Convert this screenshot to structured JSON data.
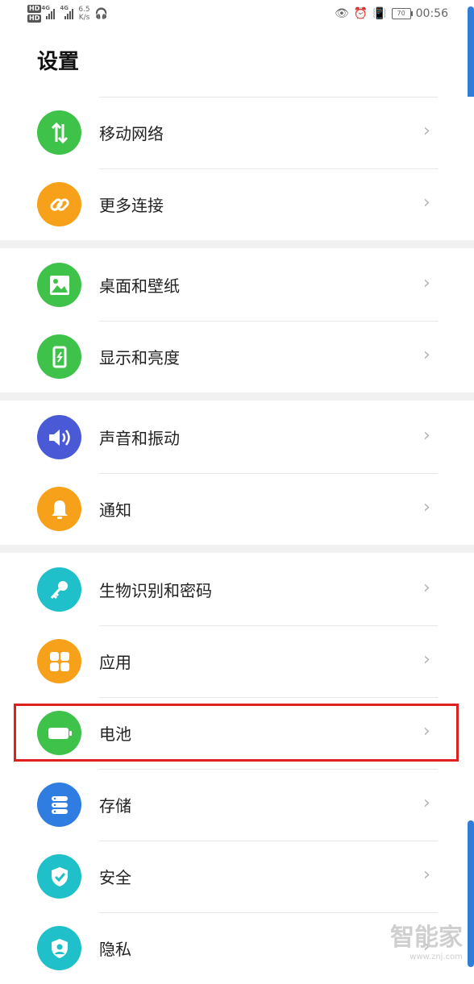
{
  "status_bar": {
    "hd1": "HD",
    "hd2": "HD",
    "net1": "4G",
    "net2": "4G",
    "speed_value": "6.5",
    "speed_unit": "K/s",
    "battery_level": "70",
    "time": "00:56"
  },
  "page": {
    "title": "设置"
  },
  "groups": [
    {
      "items": [
        {
          "label": "移动网络",
          "icon": "network-arrows-icon",
          "color": "#3fc24a"
        },
        {
          "label": "更多连接",
          "icon": "link-icon",
          "color": "#f7a11a"
        }
      ]
    },
    {
      "items": [
        {
          "label": "桌面和壁纸",
          "icon": "wallpaper-icon",
          "color": "#3fc24a"
        },
        {
          "label": "显示和亮度",
          "icon": "display-icon",
          "color": "#3fc24a"
        }
      ]
    },
    {
      "items": [
        {
          "label": "声音和振动",
          "icon": "sound-icon",
          "color": "#4a5ad6"
        },
        {
          "label": "通知",
          "icon": "bell-icon",
          "color": "#f7a11a"
        }
      ]
    },
    {
      "items": [
        {
          "label": "生物识别和密码",
          "icon": "key-icon",
          "color": "#1fc0c9"
        },
        {
          "label": "应用",
          "icon": "apps-grid-icon",
          "color": "#f7a11a"
        },
        {
          "label": "电池",
          "icon": "battery-icon",
          "color": "#3fc24a"
        },
        {
          "label": "存储",
          "icon": "storage-icon",
          "color": "#2f7de0"
        },
        {
          "label": "安全",
          "icon": "shield-check-icon",
          "color": "#1fc0c9"
        },
        {
          "label": "隐私",
          "icon": "privacy-shield-icon",
          "color": "#1fc0c9"
        }
      ]
    }
  ],
  "watermark": {
    "text": "智能家",
    "sub": "www.znj.com"
  }
}
